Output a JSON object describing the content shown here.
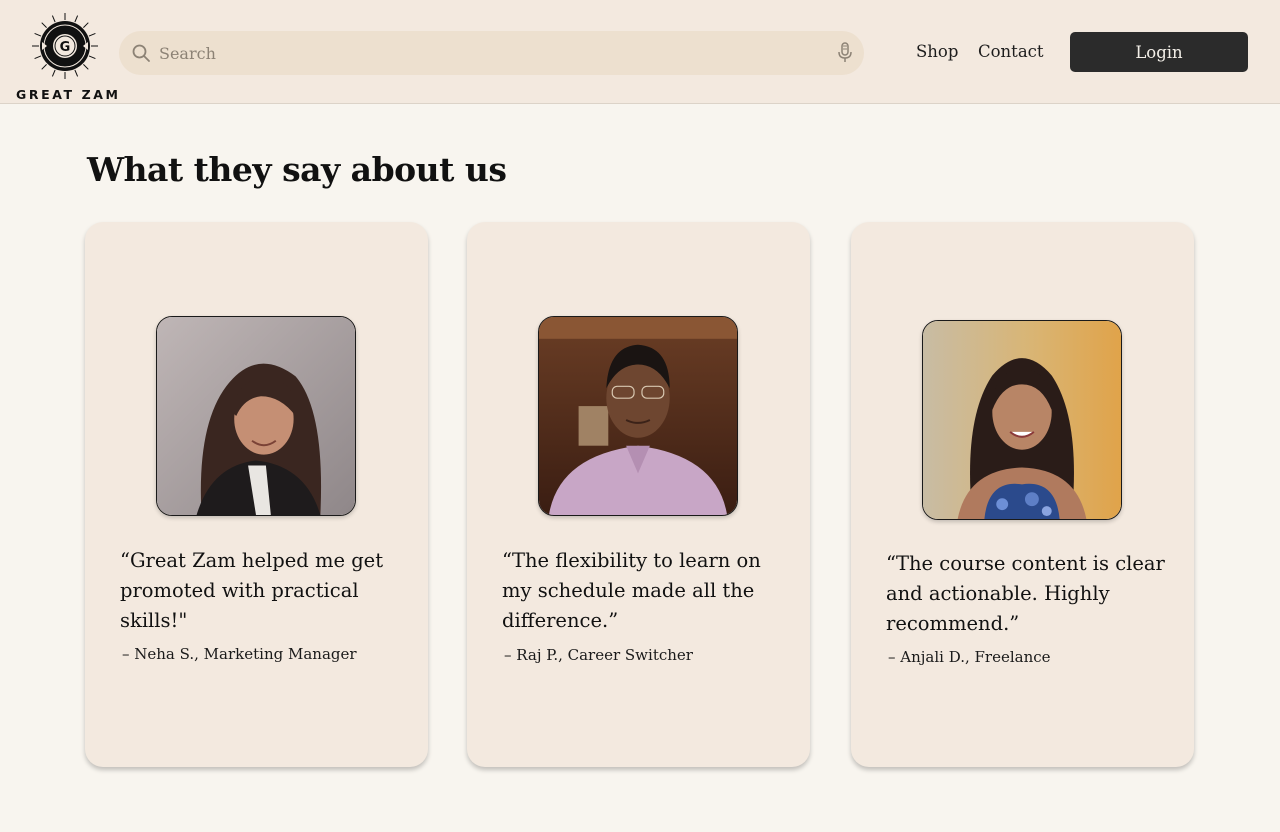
{
  "brand": {
    "name": "GREAT ZAM",
    "logo_letter": "G"
  },
  "header": {
    "search": {
      "placeholder": "Search",
      "value": ""
    },
    "nav": {
      "shop": "Shop",
      "contact": "Contact"
    },
    "login_label": "Login"
  },
  "testimonials": {
    "title": "What they say about us",
    "items": [
      {
        "quote": "“Great Zam helped me get promoted with practical skills!\"",
        "author": "– Neha S., Marketing Manager"
      },
      {
        "quote": "“The flexibility to learn on my schedule made all the difference.”",
        "author": "– Raj P., Career Switcher"
      },
      {
        "quote": "“The course content is clear and actionable. Highly recommend.”",
        "author": "– Anjali D., Freelance"
      }
    ]
  },
  "colors": {
    "header_bg": "#f3e9df",
    "page_bg": "#f8f5ef",
    "card_bg": "#f3e9df",
    "search_bg": "#ede0cf",
    "login_bg": "#2b2b2b"
  }
}
